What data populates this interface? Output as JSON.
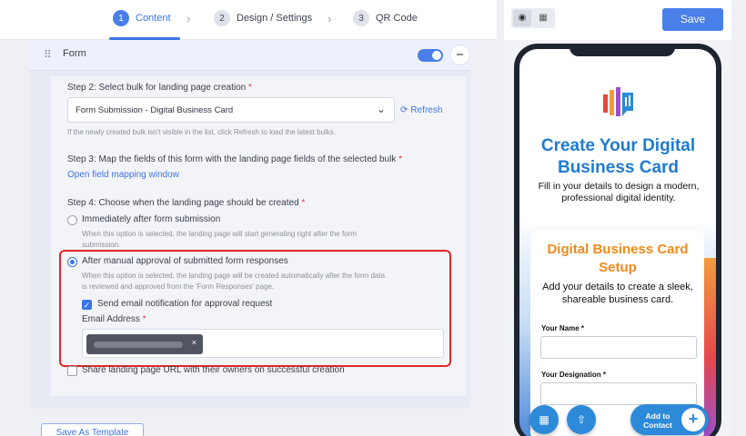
{
  "stepper": {
    "steps": [
      {
        "num": "1",
        "label": "Content"
      },
      {
        "num": "2",
        "label": "Design / Settings"
      },
      {
        "num": "3",
        "label": "QR Code"
      }
    ],
    "active_step": "1"
  },
  "form": {
    "title": "Form",
    "enabled": true,
    "step2": {
      "label": "Step 2: Select bulk for landing page creation",
      "required_mark": "*",
      "selected_value": "Form Submission - Digital Business Card",
      "refresh_label": "Refresh",
      "hint": "If the newly created bulk isn't visible in the list, click Refresh to load the latest bulks."
    },
    "step3": {
      "label": "Step 3: Map the fields of this form with the landing page fields of the selected bulk",
      "required_mark": "*",
      "link": "Open field mapping window"
    },
    "step4": {
      "label": "Step 4: Choose when the landing page should be created",
      "required_mark": "*",
      "option_immediate": {
        "label": "Immediately after form submission",
        "hint_line1": "When this option is selected, the landing page will start generating right after the form",
        "hint_line2": "submission.",
        "checked": false
      },
      "option_manual": {
        "label": "After manual approval of submitted form responses",
        "hint_line1": "When this option is selected, the landing page will be created automatically after the form data",
        "hint_line2": "is reviewed and approved from the 'Form Responses' page.",
        "checked": true
      },
      "send_email": {
        "label": "Send email notification for approval request",
        "checked": true
      },
      "email_address": {
        "label": "Email Address",
        "required_mark": "*",
        "chip_remove": "×"
      }
    },
    "share_url": {
      "label": "Share landing page URL with their owners on successful creation",
      "checked": false
    }
  },
  "save_template_label": "Save As Template",
  "preview": {
    "save_label": "Save",
    "view_icons": [
      "eye-icon",
      "qr-icon"
    ],
    "title": "Create Your Digital Business Card",
    "subtitle": "Fill in your details to design a modern, professional digital identity.",
    "card": {
      "title": "Digital Business Card Setup",
      "subtitle": "Add your details to create a sleek, shareable business card.",
      "fields": [
        {
          "label": "Your Name *"
        },
        {
          "label": "Your Designation *"
        }
      ]
    },
    "contact_button": "Add to Contact"
  },
  "colors": {
    "accent": "#3b74e6",
    "highlight_border": "#e02828",
    "preview_title": "#1f7bd1",
    "card_title": "#f08a1c"
  }
}
